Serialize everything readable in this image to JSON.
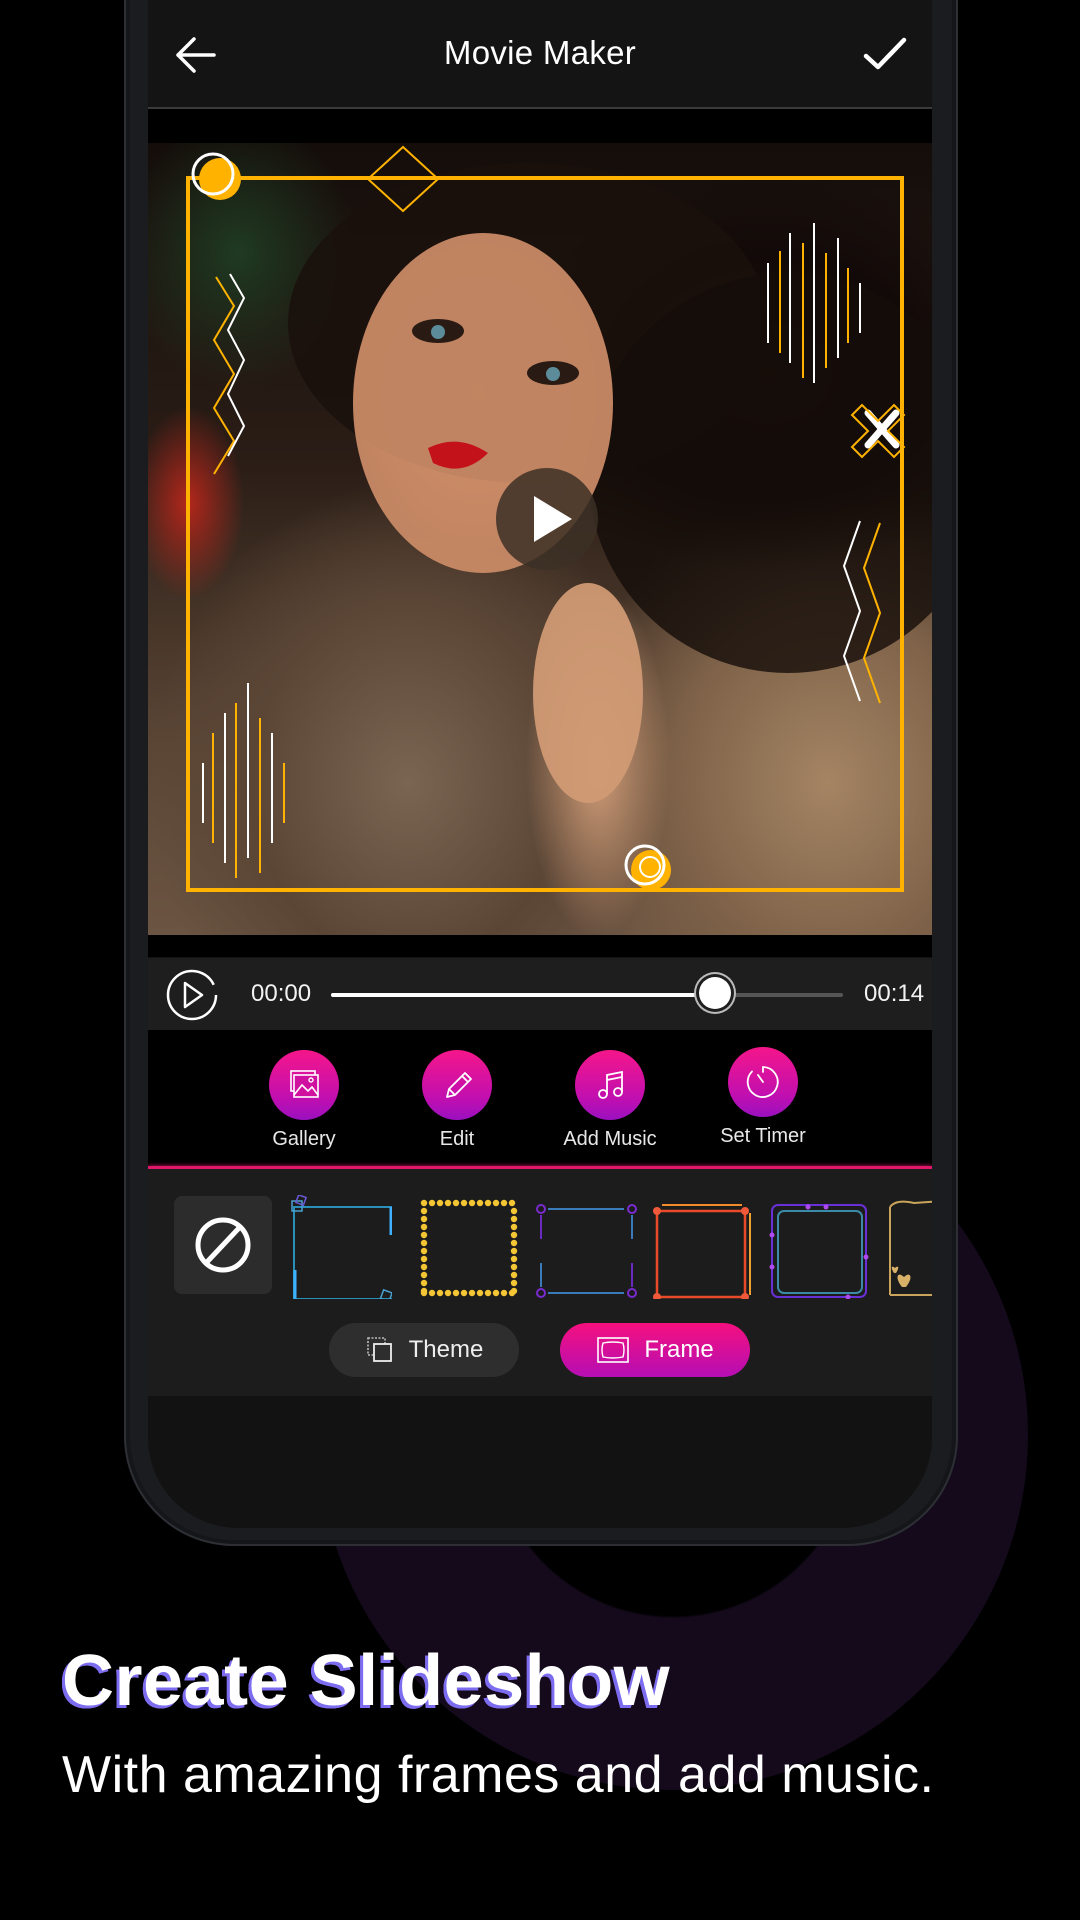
{
  "app": {
    "title": "Movie Maker",
    "back_icon": "arrow-left-icon",
    "confirm_icon": "check-icon"
  },
  "preview": {
    "play_icon": "play-icon",
    "frame_color": "#ffb300"
  },
  "player": {
    "current_time": "00:00",
    "total_time": "00:14",
    "progress": 0.75,
    "play_icon": "play-circle-icon"
  },
  "tools": [
    {
      "label": "Gallery",
      "icon": "gallery-icon"
    },
    {
      "label": "Edit",
      "icon": "pencil-icon"
    },
    {
      "label": "Add Music",
      "icon": "music-note-icon"
    },
    {
      "label": "Set Timer",
      "icon": "timer-icon"
    }
  ],
  "frames": {
    "none_icon": "no-frame-icon",
    "items": [
      {
        "name": "blue-corner-frame",
        "color": "#3fa6e0"
      },
      {
        "name": "gold-dotted-frame",
        "color": "#f4c534"
      },
      {
        "name": "purple-pin-frame",
        "color": "#7a2ad0"
      },
      {
        "name": "red-orange-neon-frame",
        "color": "#f04a3a"
      },
      {
        "name": "purple-teal-frame",
        "color": "#8a3ae8"
      },
      {
        "name": "gold-hearts-frame",
        "color": "#c9a45a"
      }
    ]
  },
  "tabs": [
    {
      "label": "Theme",
      "icon": "theme-icon",
      "active": false
    },
    {
      "label": "Frame",
      "icon": "frame-icon",
      "active": true
    }
  ],
  "colors": {
    "accent_pink": "#f5168a",
    "accent_purple": "#9a10c0",
    "background": "#000000"
  },
  "promo": {
    "headline": "Create Slideshow",
    "subtitle": "With amazing frames and add music."
  }
}
